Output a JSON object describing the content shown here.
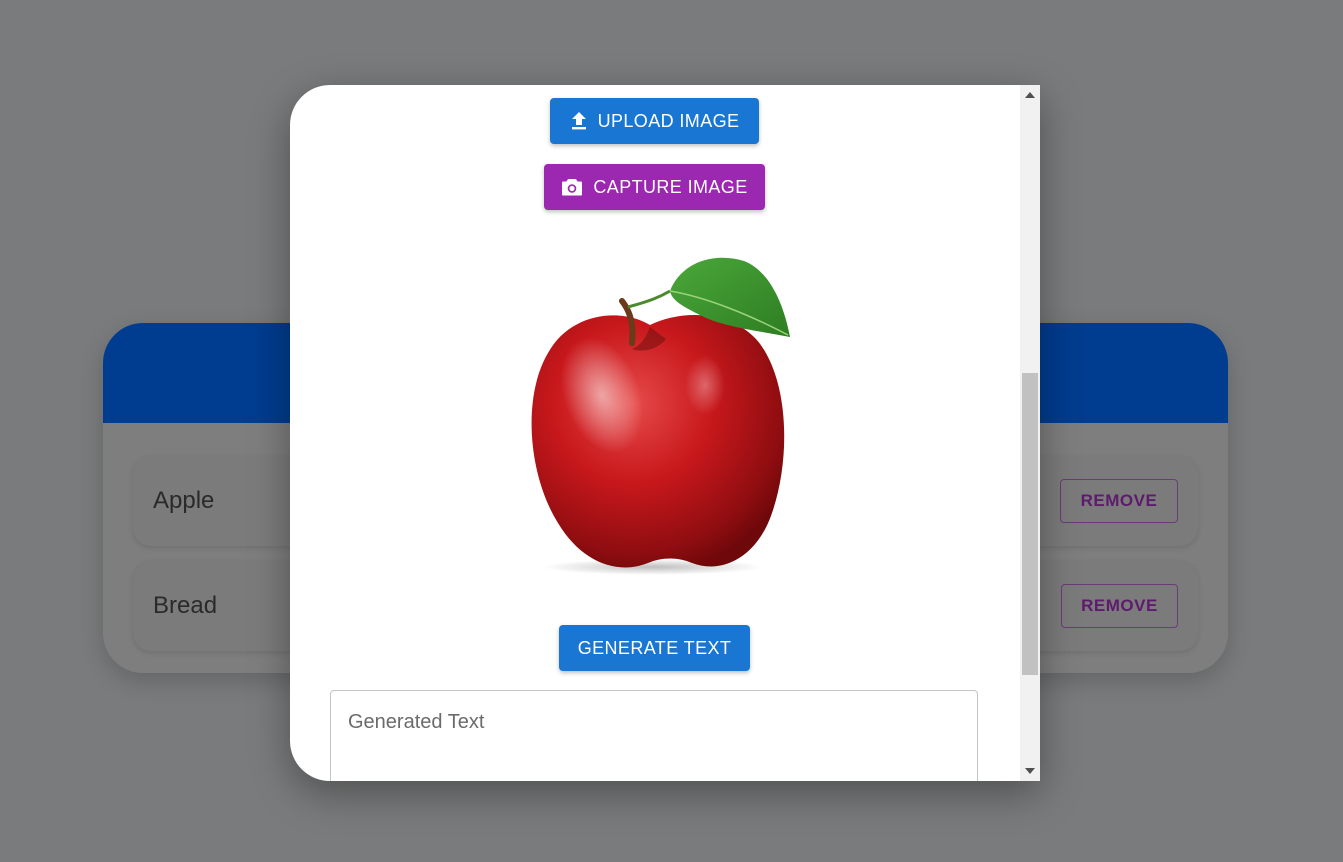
{
  "background_card": {
    "items": [
      {
        "label": "Apple",
        "remove_label": "REMOVE"
      },
      {
        "label": "Bread",
        "remove_label": "REMOVE"
      }
    ]
  },
  "modal": {
    "upload_label": "UPLOAD IMAGE",
    "capture_label": "CAPTURE IMAGE",
    "generate_label": "GENERATE TEXT",
    "generated_placeholder": "Generated Text",
    "generated_value": ""
  },
  "colors": {
    "upload": "#1976d2",
    "capture": "#9c27b0",
    "generate": "#1976d2",
    "card_header": "#003c8f",
    "remove_text": "#5e1b6e"
  },
  "icons": {
    "upload": "upload-icon",
    "capture": "camera-icon",
    "image": "apple-image"
  }
}
